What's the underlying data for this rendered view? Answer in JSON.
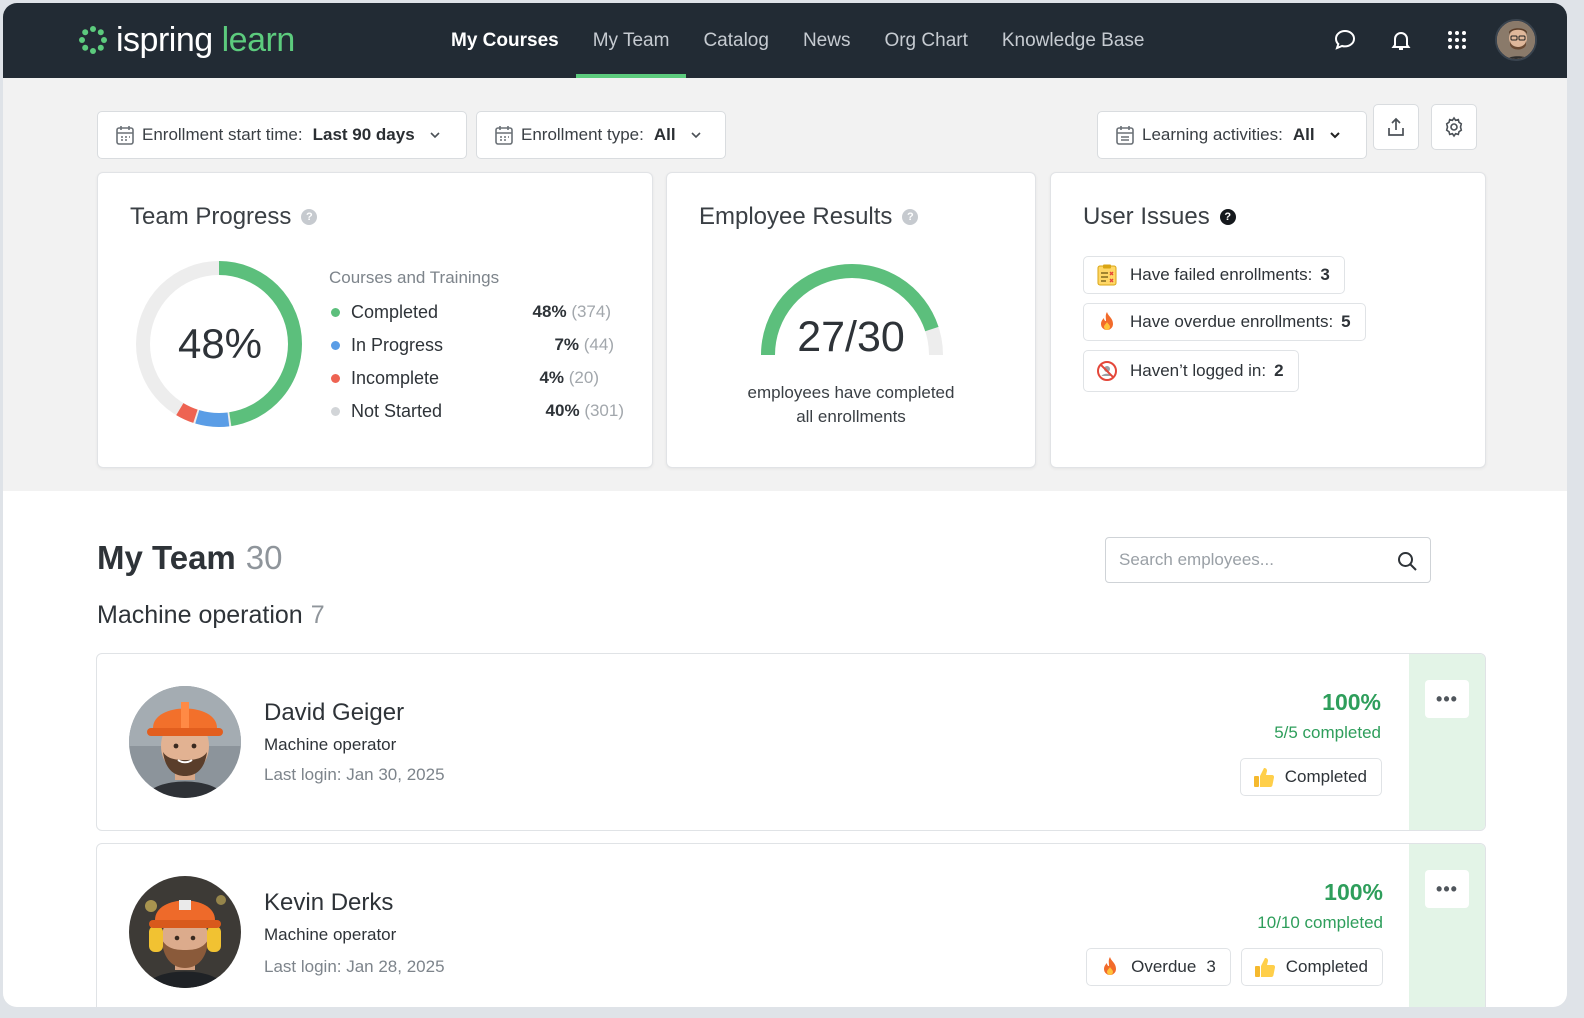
{
  "brand": {
    "part1": "ispring",
    "part2": "learn"
  },
  "nav": {
    "items": [
      {
        "label": "My Courses"
      },
      {
        "label": "My Team"
      },
      {
        "label": "Catalog"
      },
      {
        "label": "News"
      },
      {
        "label": "Org Chart"
      },
      {
        "label": "Knowledge Base"
      }
    ],
    "active": "My Team"
  },
  "filters": {
    "enrollment_start": {
      "label": "Enrollment start time:",
      "value": "Last 90 days"
    },
    "enrollment_type": {
      "label": "Enrollment type:",
      "value": "All"
    },
    "learning_activities": {
      "label": "Learning activities:",
      "value": "All"
    }
  },
  "team_progress": {
    "title": "Team Progress",
    "percent": "48%",
    "legend_title": "Courses and Trainings",
    "rows": [
      {
        "label": "Completed",
        "pct": "48%",
        "count": "(374)",
        "color": "#5cbf7c",
        "fraction": 0.48
      },
      {
        "label": "In Progress",
        "pct": "7%",
        "count": "(44)",
        "color": "#5a9de6",
        "fraction": 0.07
      },
      {
        "label": "Incomplete",
        "pct": "4%",
        "count": "(20)",
        "color": "#ee6352",
        "fraction": 0.04
      },
      {
        "label": "Not Started",
        "pct": "40%",
        "count": "(301)",
        "color": "#d2d5d8",
        "fraction": 0.4
      }
    ]
  },
  "employee_results": {
    "title": "Employee Results",
    "value": "27/30",
    "completed": 27,
    "total": 30,
    "caption_line1": "employees have completed",
    "caption_line2": "all enrollments"
  },
  "user_issues": {
    "title": "User Issues",
    "items": [
      {
        "label": "Have failed enrollments:",
        "count": "3"
      },
      {
        "label": "Have overdue enrollments:",
        "count": "5"
      },
      {
        "label": "Haven’t logged in:",
        "count": "2"
      }
    ]
  },
  "team": {
    "title": "My Team",
    "count": "30",
    "search_placeholder": "Search employees...",
    "group": {
      "name": "Machine operation",
      "count": "7"
    },
    "employees": [
      {
        "name": "David Geiger",
        "role": "Machine operator",
        "login": "Last login: Jan 30, 2025",
        "percent": "100%",
        "completed": "5/5 completed",
        "status": "Completed"
      },
      {
        "name": "Kevin Derks",
        "role": "Machine operator",
        "login": "Last login: Jan 28, 2025",
        "percent": "100%",
        "completed": "10/10 completed",
        "overdue_label": "Overdue",
        "overdue_count": "3",
        "status": "Completed"
      }
    ]
  },
  "colors": {
    "accent": "#5ccb7d",
    "nav_bg": "#222b34",
    "success": "#2e9e5b"
  }
}
